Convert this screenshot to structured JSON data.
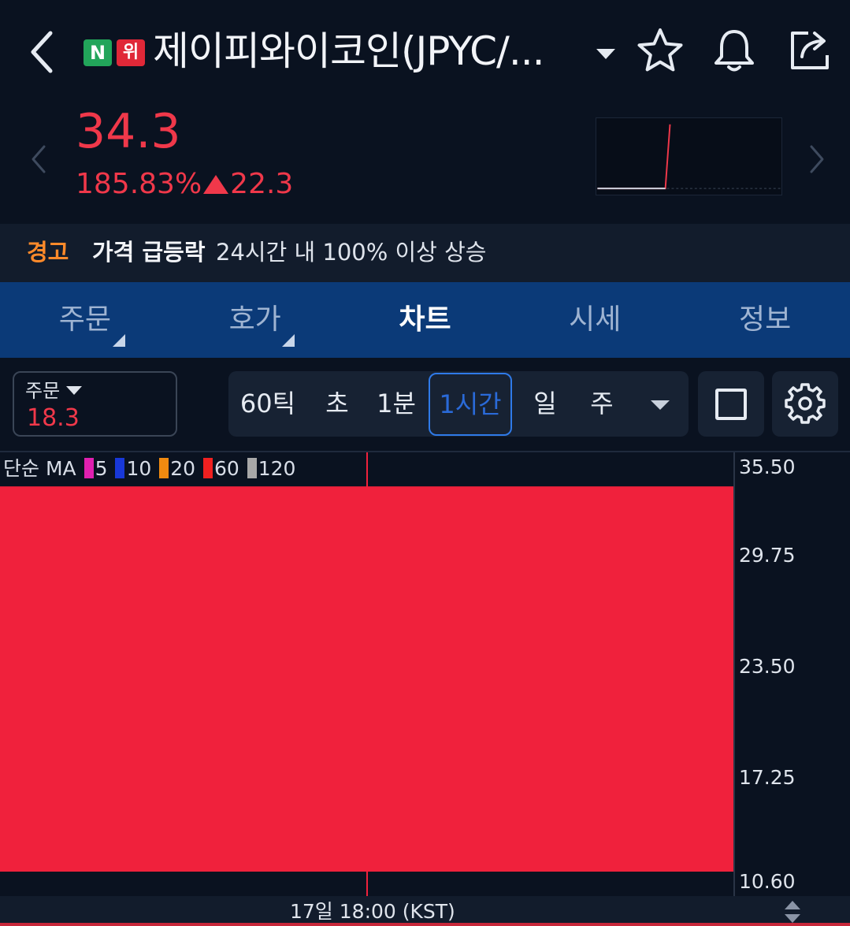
{
  "header": {
    "badge_n": "N",
    "badge_w": "위",
    "title": "제이피와이코인(JPYC/..."
  },
  "price": {
    "current": "34.3",
    "change_percent": "185.83%",
    "change_amount": "22.3",
    "color": "#f0384a"
  },
  "warning": {
    "tag": "경고",
    "title": "가격 급등락",
    "text": "24시간 내 100% 이상 상승"
  },
  "tabs": [
    {
      "label": "주문"
    },
    {
      "label": "호가"
    },
    {
      "label": "차트",
      "active": true
    },
    {
      "label": "시세"
    },
    {
      "label": "정보"
    }
  ],
  "controls": {
    "order_label": "주문",
    "order_value": "18.3",
    "periods": [
      "60틱",
      "초",
      "1분",
      "1시간",
      "일",
      "주"
    ],
    "selected_period": "1시간"
  },
  "chart_legend": {
    "prefix": "단순 MA",
    "items": [
      {
        "label": "5",
        "color": "#e020b0"
      },
      {
        "label": "10",
        "color": "#1838d8"
      },
      {
        "label": "20",
        "color": "#f08a10"
      },
      {
        "label": "60",
        "color": "#f02020"
      },
      {
        "label": "120",
        "color": "#a8a8a8"
      }
    ]
  },
  "chart_data": {
    "type": "candlestick",
    "y_ticks": [
      "35.50",
      "29.75",
      "23.50",
      "17.25",
      "10.60"
    ],
    "ylim": [
      10.6,
      35.5
    ],
    "candle": {
      "open": 10.6,
      "close": 34.3,
      "color": "#f0213c"
    },
    "x_label": "17일 18:00 (KST)"
  },
  "colors": {
    "accent": "#2f7ae8",
    "up": "#f0384a",
    "tab_bg": "#0b3a78",
    "warning_tag": "#ff8a2a"
  }
}
